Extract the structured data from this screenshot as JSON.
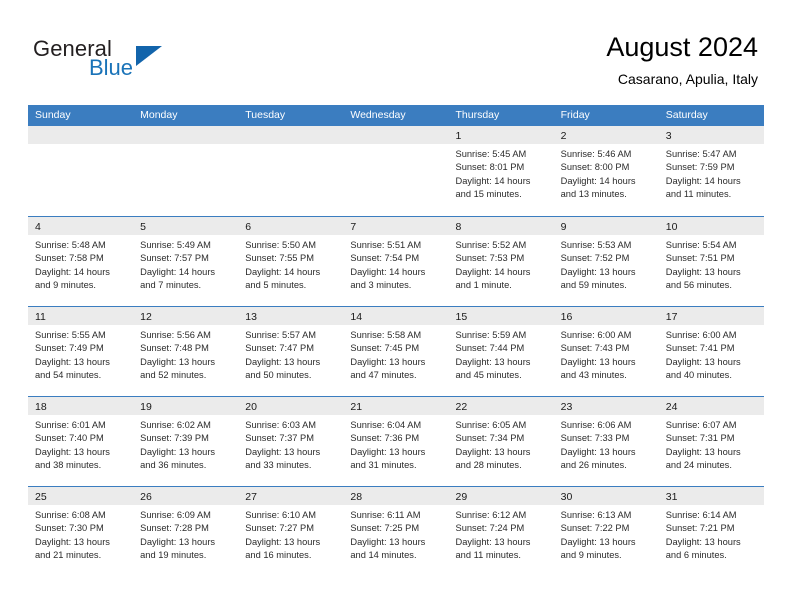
{
  "brand": {
    "word1": "General",
    "word2": "Blue",
    "triangle_color": "#1264ab",
    "blue_color": "#1a73b8"
  },
  "header": {
    "title": "August 2024",
    "subtitle": "Casarano, Apulia, Italy"
  },
  "theme": {
    "header_blue": "#3b7dc0",
    "day_band_gray": "#ebebeb",
    "text": "#000000"
  },
  "calendar": {
    "day_names": [
      "Sunday",
      "Monday",
      "Tuesday",
      "Wednesday",
      "Thursday",
      "Friday",
      "Saturday"
    ],
    "weeks": [
      [
        {
          "day": "",
          "sunrise": "",
          "sunset": "",
          "daylight1": "",
          "daylight2": ""
        },
        {
          "day": "",
          "sunrise": "",
          "sunset": "",
          "daylight1": "",
          "daylight2": ""
        },
        {
          "day": "",
          "sunrise": "",
          "sunset": "",
          "daylight1": "",
          "daylight2": ""
        },
        {
          "day": "",
          "sunrise": "",
          "sunset": "",
          "daylight1": "",
          "daylight2": ""
        },
        {
          "day": "1",
          "sunrise": "Sunrise: 5:45 AM",
          "sunset": "Sunset: 8:01 PM",
          "daylight1": "Daylight: 14 hours",
          "daylight2": "and 15 minutes."
        },
        {
          "day": "2",
          "sunrise": "Sunrise: 5:46 AM",
          "sunset": "Sunset: 8:00 PM",
          "daylight1": "Daylight: 14 hours",
          "daylight2": "and 13 minutes."
        },
        {
          "day": "3",
          "sunrise": "Sunrise: 5:47 AM",
          "sunset": "Sunset: 7:59 PM",
          "daylight1": "Daylight: 14 hours",
          "daylight2": "and 11 minutes."
        }
      ],
      [
        {
          "day": "4",
          "sunrise": "Sunrise: 5:48 AM",
          "sunset": "Sunset: 7:58 PM",
          "daylight1": "Daylight: 14 hours",
          "daylight2": "and 9 minutes."
        },
        {
          "day": "5",
          "sunrise": "Sunrise: 5:49 AM",
          "sunset": "Sunset: 7:57 PM",
          "daylight1": "Daylight: 14 hours",
          "daylight2": "and 7 minutes."
        },
        {
          "day": "6",
          "sunrise": "Sunrise: 5:50 AM",
          "sunset": "Sunset: 7:55 PM",
          "daylight1": "Daylight: 14 hours",
          "daylight2": "and 5 minutes."
        },
        {
          "day": "7",
          "sunrise": "Sunrise: 5:51 AM",
          "sunset": "Sunset: 7:54 PM",
          "daylight1": "Daylight: 14 hours",
          "daylight2": "and 3 minutes."
        },
        {
          "day": "8",
          "sunrise": "Sunrise: 5:52 AM",
          "sunset": "Sunset: 7:53 PM",
          "daylight1": "Daylight: 14 hours",
          "daylight2": "and 1 minute."
        },
        {
          "day": "9",
          "sunrise": "Sunrise: 5:53 AM",
          "sunset": "Sunset: 7:52 PM",
          "daylight1": "Daylight: 13 hours",
          "daylight2": "and 59 minutes."
        },
        {
          "day": "10",
          "sunrise": "Sunrise: 5:54 AM",
          "sunset": "Sunset: 7:51 PM",
          "daylight1": "Daylight: 13 hours",
          "daylight2": "and 56 minutes."
        }
      ],
      [
        {
          "day": "11",
          "sunrise": "Sunrise: 5:55 AM",
          "sunset": "Sunset: 7:49 PM",
          "daylight1": "Daylight: 13 hours",
          "daylight2": "and 54 minutes."
        },
        {
          "day": "12",
          "sunrise": "Sunrise: 5:56 AM",
          "sunset": "Sunset: 7:48 PM",
          "daylight1": "Daylight: 13 hours",
          "daylight2": "and 52 minutes."
        },
        {
          "day": "13",
          "sunrise": "Sunrise: 5:57 AM",
          "sunset": "Sunset: 7:47 PM",
          "daylight1": "Daylight: 13 hours",
          "daylight2": "and 50 minutes."
        },
        {
          "day": "14",
          "sunrise": "Sunrise: 5:58 AM",
          "sunset": "Sunset: 7:45 PM",
          "daylight1": "Daylight: 13 hours",
          "daylight2": "and 47 minutes."
        },
        {
          "day": "15",
          "sunrise": "Sunrise: 5:59 AM",
          "sunset": "Sunset: 7:44 PM",
          "daylight1": "Daylight: 13 hours",
          "daylight2": "and 45 minutes."
        },
        {
          "day": "16",
          "sunrise": "Sunrise: 6:00 AM",
          "sunset": "Sunset: 7:43 PM",
          "daylight1": "Daylight: 13 hours",
          "daylight2": "and 43 minutes."
        },
        {
          "day": "17",
          "sunrise": "Sunrise: 6:00 AM",
          "sunset": "Sunset: 7:41 PM",
          "daylight1": "Daylight: 13 hours",
          "daylight2": "and 40 minutes."
        }
      ],
      [
        {
          "day": "18",
          "sunrise": "Sunrise: 6:01 AM",
          "sunset": "Sunset: 7:40 PM",
          "daylight1": "Daylight: 13 hours",
          "daylight2": "and 38 minutes."
        },
        {
          "day": "19",
          "sunrise": "Sunrise: 6:02 AM",
          "sunset": "Sunset: 7:39 PM",
          "daylight1": "Daylight: 13 hours",
          "daylight2": "and 36 minutes."
        },
        {
          "day": "20",
          "sunrise": "Sunrise: 6:03 AM",
          "sunset": "Sunset: 7:37 PM",
          "daylight1": "Daylight: 13 hours",
          "daylight2": "and 33 minutes."
        },
        {
          "day": "21",
          "sunrise": "Sunrise: 6:04 AM",
          "sunset": "Sunset: 7:36 PM",
          "daylight1": "Daylight: 13 hours",
          "daylight2": "and 31 minutes."
        },
        {
          "day": "22",
          "sunrise": "Sunrise: 6:05 AM",
          "sunset": "Sunset: 7:34 PM",
          "daylight1": "Daylight: 13 hours",
          "daylight2": "and 28 minutes."
        },
        {
          "day": "23",
          "sunrise": "Sunrise: 6:06 AM",
          "sunset": "Sunset: 7:33 PM",
          "daylight1": "Daylight: 13 hours",
          "daylight2": "and 26 minutes."
        },
        {
          "day": "24",
          "sunrise": "Sunrise: 6:07 AM",
          "sunset": "Sunset: 7:31 PM",
          "daylight1": "Daylight: 13 hours",
          "daylight2": "and 24 minutes."
        }
      ],
      [
        {
          "day": "25",
          "sunrise": "Sunrise: 6:08 AM",
          "sunset": "Sunset: 7:30 PM",
          "daylight1": "Daylight: 13 hours",
          "daylight2": "and 21 minutes."
        },
        {
          "day": "26",
          "sunrise": "Sunrise: 6:09 AM",
          "sunset": "Sunset: 7:28 PM",
          "daylight1": "Daylight: 13 hours",
          "daylight2": "and 19 minutes."
        },
        {
          "day": "27",
          "sunrise": "Sunrise: 6:10 AM",
          "sunset": "Sunset: 7:27 PM",
          "daylight1": "Daylight: 13 hours",
          "daylight2": "and 16 minutes."
        },
        {
          "day": "28",
          "sunrise": "Sunrise: 6:11 AM",
          "sunset": "Sunset: 7:25 PM",
          "daylight1": "Daylight: 13 hours",
          "daylight2": "and 14 minutes."
        },
        {
          "day": "29",
          "sunrise": "Sunrise: 6:12 AM",
          "sunset": "Sunset: 7:24 PM",
          "daylight1": "Daylight: 13 hours",
          "daylight2": "and 11 minutes."
        },
        {
          "day": "30",
          "sunrise": "Sunrise: 6:13 AM",
          "sunset": "Sunset: 7:22 PM",
          "daylight1": "Daylight: 13 hours",
          "daylight2": "and 9 minutes."
        },
        {
          "day": "31",
          "sunrise": "Sunrise: 6:14 AM",
          "sunset": "Sunset: 7:21 PM",
          "daylight1": "Daylight: 13 hours",
          "daylight2": "and 6 minutes."
        }
      ]
    ]
  }
}
